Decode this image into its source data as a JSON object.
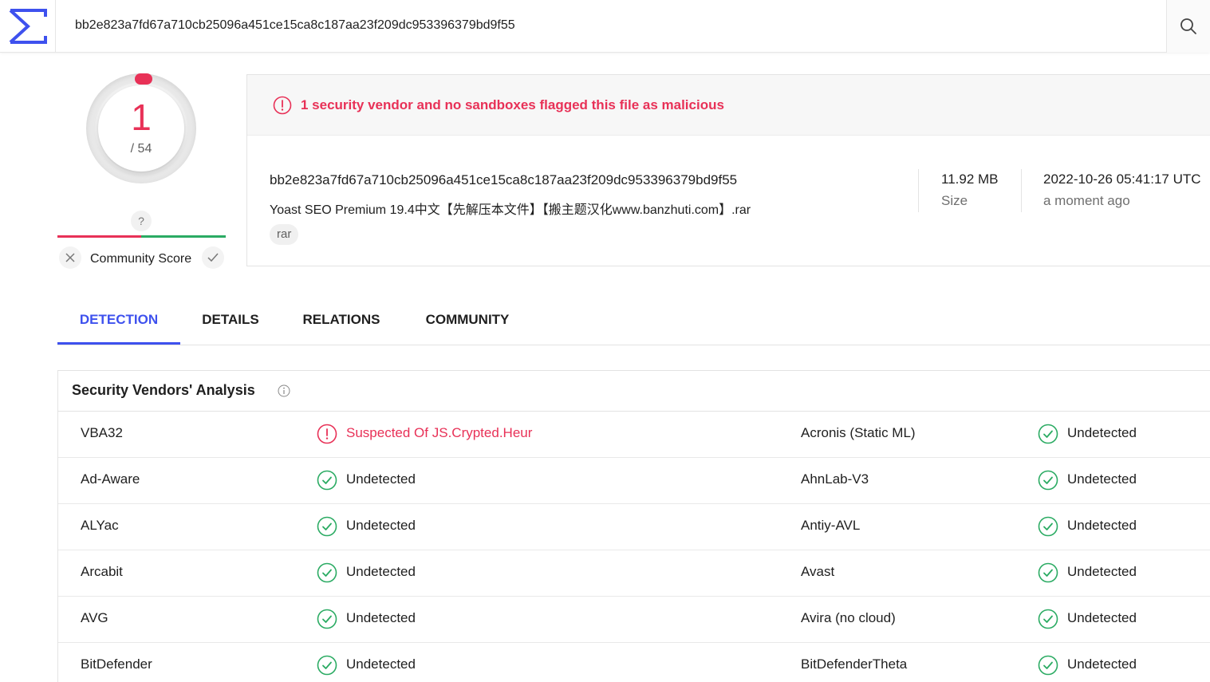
{
  "search": {
    "value": "bb2e823a7fd67a710cb25096a451ce15ca8c187aa23f209dc953396379bd9f55"
  },
  "score": {
    "detections": "1",
    "total": "/ 54",
    "community_unknown": "?",
    "community_label": "Community Score"
  },
  "summary": {
    "alert": "1 security vendor and no sandboxes flagged this file as malicious",
    "hash": "bb2e823a7fd67a710cb25096a451ce15ca8c187aa23f209dc953396379bd9f55",
    "filename": "Yoast SEO Premium 19.4中文【先解压本文件】【搬主题汉化www.banzhuti.com】.rar",
    "tag": "rar",
    "size_value": "11.92 MB",
    "size_label": "Size",
    "date_value": "2022-10-26 05:41:17 UTC",
    "date_label": "a moment ago"
  },
  "tabs": [
    {
      "label": "DETECTION",
      "active": true
    },
    {
      "label": "DETAILS",
      "active": false
    },
    {
      "label": "RELATIONS",
      "active": false
    },
    {
      "label": "COMMUNITY",
      "active": false
    }
  ],
  "analysis": {
    "title": "Security Vendors' Analysis",
    "rows": [
      {
        "left_vendor": "VBA32",
        "left_result": "Suspected Of JS.Crypted.Heur",
        "left_status": "malicious",
        "right_vendor": "Acronis (Static ML)",
        "right_result": "Undetected",
        "right_status": "undetected"
      },
      {
        "left_vendor": "Ad-Aware",
        "left_result": "Undetected",
        "left_status": "undetected",
        "right_vendor": "AhnLab-V3",
        "right_result": "Undetected",
        "right_status": "undetected"
      },
      {
        "left_vendor": "ALYac",
        "left_result": "Undetected",
        "left_status": "undetected",
        "right_vendor": "Antiy-AVL",
        "right_result": "Undetected",
        "right_status": "undetected"
      },
      {
        "left_vendor": "Arcabit",
        "left_result": "Undetected",
        "left_status": "undetected",
        "right_vendor": "Avast",
        "right_result": "Undetected",
        "right_status": "undetected"
      },
      {
        "left_vendor": "AVG",
        "left_result": "Undetected",
        "left_status": "undetected",
        "right_vendor": "Avira (no cloud)",
        "right_result": "Undetected",
        "right_status": "undetected"
      },
      {
        "left_vendor": "BitDefender",
        "left_result": "Undetected",
        "left_status": "undetected",
        "right_vendor": "BitDefenderTheta",
        "right_result": "Undetected",
        "right_status": "undetected"
      }
    ]
  },
  "colors": {
    "accent": "#3e51ee",
    "malicious": "#e83157",
    "clean": "#2bab63"
  },
  "icons": {
    "logo": "sigma-logo-icon",
    "search": "search-icon",
    "alert": "alert-circle-icon",
    "info": "info-icon",
    "check": "check-circle-icon",
    "vote_down": "close-icon",
    "vote_up": "check-icon"
  }
}
